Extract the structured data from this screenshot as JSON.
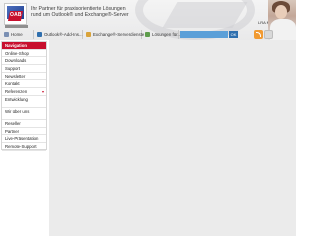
{
  "header": {
    "logo_text": "OAB",
    "tagline_line1": "Ihr Partner für praxisorientierte Lösungen",
    "tagline_line2": "rund um Outlook® und Exchange®-Server",
    "person_label": "LRA Main"
  },
  "tabs": [
    {
      "label": "Home",
      "icon": "home-icon"
    },
    {
      "label": "Outlook®-Add-Ins...",
      "icon": "outlook-icon"
    },
    {
      "label": "Exchange®-Serverdienste",
      "icon": "exchange-icon"
    },
    {
      "label": "Lösungen für...",
      "icon": "solutions-icon"
    }
  ],
  "search": {
    "placeholder": "",
    "button_label": "OK"
  },
  "sidebar": {
    "items": [
      {
        "label": "Navigation",
        "active": true
      },
      {
        "label": "Online-Shop"
      },
      {
        "label": "Downloads"
      },
      {
        "label": "Support"
      },
      {
        "label": "Newsletter"
      },
      {
        "label": "Kontakt"
      },
      {
        "label": "Referenzen",
        "has_submenu": true
      },
      {
        "label": "Entwicklung"
      },
      {
        "label": "Wir über uns"
      },
      {
        "label": "Reseller"
      },
      {
        "label": "Partner"
      },
      {
        "label": "Live-Präsentation"
      },
      {
        "label": "Remote-Support"
      }
    ]
  },
  "colors": {
    "accent": "#c8102e",
    "search_bg": "#5b9fd8",
    "content_bg": "#ebebeb"
  }
}
